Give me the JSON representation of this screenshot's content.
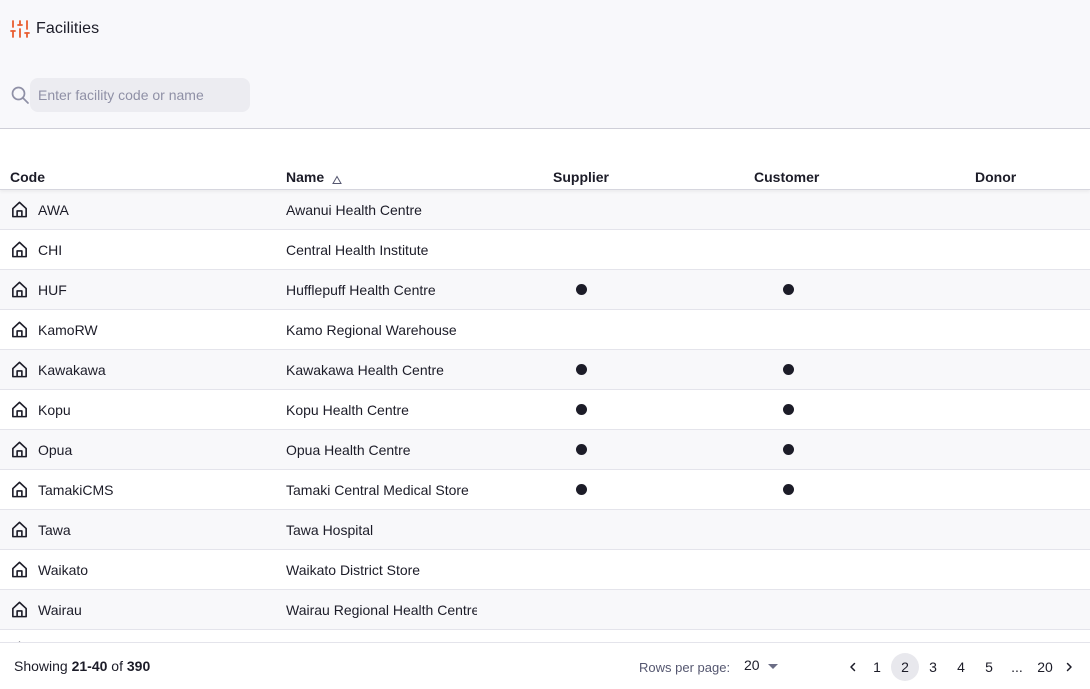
{
  "header": {
    "title": "Facilities",
    "title_icon": "sliders-icon",
    "accent_color": "#e95c30"
  },
  "search": {
    "placeholder": "Enter facility code or name",
    "value": ""
  },
  "table": {
    "columns": [
      {
        "key": "code",
        "label": "Code"
      },
      {
        "key": "name",
        "label": "Name",
        "sort": "ascending"
      },
      {
        "key": "supplier",
        "label": "Supplier"
      },
      {
        "key": "customer",
        "label": "Customer"
      },
      {
        "key": "donor",
        "label": "Donor"
      }
    ],
    "rows": [
      {
        "code": "AWA",
        "name": "Awanui Health Centre",
        "supplier": false,
        "customer": false,
        "donor": false
      },
      {
        "code": "CHI",
        "name": "Central Health Institute",
        "supplier": false,
        "customer": false,
        "donor": false
      },
      {
        "code": "HUF",
        "name": "Hufflepuff Health Centre",
        "supplier": true,
        "customer": true,
        "donor": false
      },
      {
        "code": "KamoRW",
        "name": "Kamo Regional Warehouse",
        "supplier": false,
        "customer": false,
        "donor": false
      },
      {
        "code": "Kawakawa",
        "name": "Kawakawa Health Centre",
        "supplier": true,
        "customer": true,
        "donor": false
      },
      {
        "code": "Kopu",
        "name": "Kopu Health Centre",
        "supplier": true,
        "customer": true,
        "donor": false
      },
      {
        "code": "Opua",
        "name": "Opua Health Centre",
        "supplier": true,
        "customer": true,
        "donor": false
      },
      {
        "code": "TamakiCMS",
        "name": "Tamaki Central Medical Store",
        "supplier": true,
        "customer": true,
        "donor": false
      },
      {
        "code": "Tawa",
        "name": "Tawa Hospital",
        "supplier": false,
        "customer": false,
        "donor": false
      },
      {
        "code": "Waikato",
        "name": "Waikato District Store",
        "supplier": false,
        "customer": false,
        "donor": false
      },
      {
        "code": "Wairau",
        "name": "Wairau Regional Health Centre",
        "supplier": false,
        "customer": false,
        "donor": false
      },
      {
        "code": "",
        "name": "",
        "supplier": false,
        "customer": false,
        "donor": false
      }
    ]
  },
  "footer": {
    "showing_prefix": "Showing",
    "range": "21-40",
    "of_label": "of",
    "total": "390",
    "rows_per_page_label": "Rows per page:",
    "rows_per_page_value": "20",
    "pages": [
      "1",
      "2",
      "3",
      "4",
      "5",
      "...",
      "20"
    ],
    "current_page": "2"
  }
}
